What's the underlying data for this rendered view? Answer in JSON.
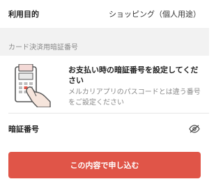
{
  "purpose": {
    "label": "利用目的",
    "value": "ショッピング（個人用途）"
  },
  "section": {
    "title": "カード決済用暗証番号"
  },
  "info": {
    "title": "お支払い時の暗証番号を設定してください",
    "description": "メルカリアプリのパスコードとは違う番号をご設定ください",
    "illustration": "card-terminal-hand-illustration"
  },
  "pin": {
    "label": "暗証番号",
    "toggle_icon": "eye-off-icon"
  },
  "submit": {
    "label": "この内容で申し込む",
    "color": "#e05548"
  }
}
